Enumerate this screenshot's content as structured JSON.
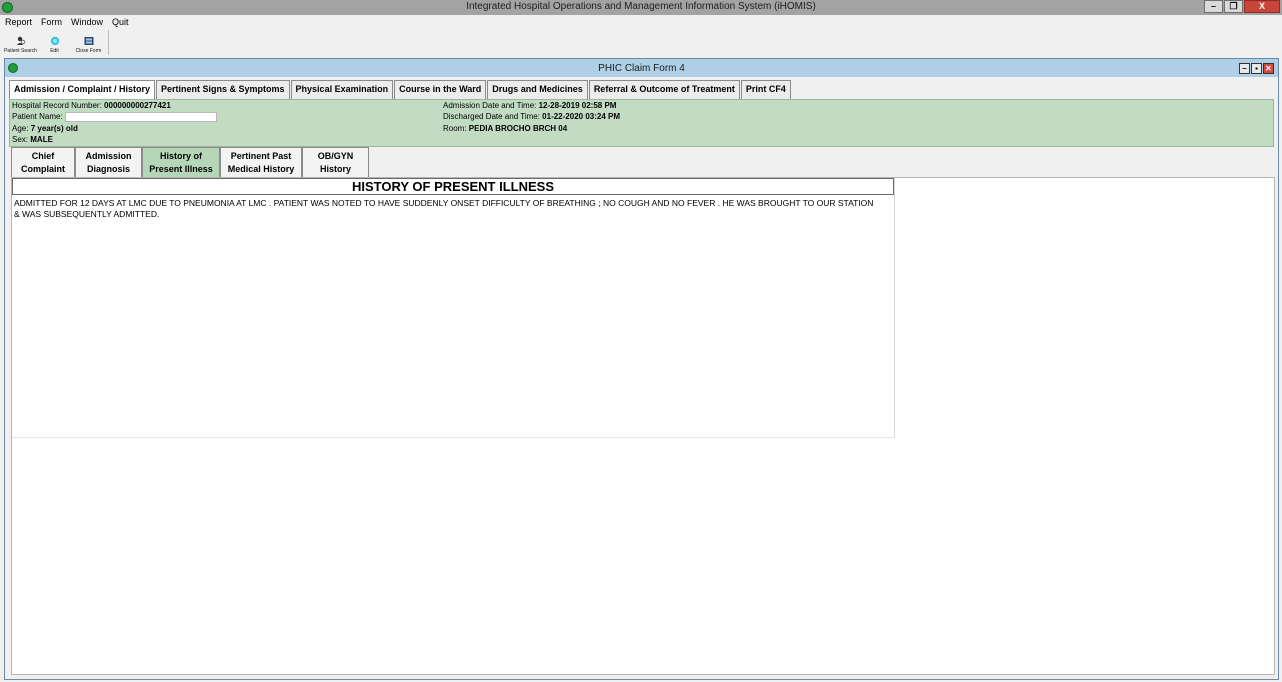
{
  "app": {
    "title": "Integrated Hospital Operations and Management Information System (iHOMIS)"
  },
  "window_controls": {
    "minimize": "–",
    "restore": "❐",
    "close": "X"
  },
  "menu": [
    {
      "label": "Report"
    },
    {
      "label": "Form"
    },
    {
      "label": "Window"
    },
    {
      "label": "Quit"
    }
  ],
  "toolbar": [
    {
      "label": "Patient Search",
      "icon": "patient-search-icon"
    },
    {
      "label": "Edit",
      "icon": "edit-icon"
    },
    {
      "label": "Close Form",
      "icon": "close-form-icon"
    }
  ],
  "child": {
    "title": "PHIC Claim Form 4",
    "controls": {
      "minimize": "–",
      "maximize": "▪",
      "close": "✕"
    }
  },
  "tabs": [
    {
      "label": "Admission / Complaint / History",
      "active": true
    },
    {
      "label": "Pertinent Signs & Symptoms"
    },
    {
      "label": "Physical Examination"
    },
    {
      "label": "Course in the Ward"
    },
    {
      "label": "Drugs and Medicines"
    },
    {
      "label": "Referral & Outcome of Treatment"
    },
    {
      "label": "Print CF4"
    }
  ],
  "patient": {
    "hrn_label": "Hospital Record Number:",
    "hrn": "000000000277421",
    "name_label": "Patient Name:",
    "name_value": "",
    "age_label": "Age:",
    "age": "7 year(s) old",
    "sex_label": "Sex:",
    "sex": "MALE",
    "admission_label": "Admission Date and Time:",
    "admission": "12-28-2019 02:58 PM",
    "discharged_label": "Discharged Date and Time:",
    "discharged": "01-22-2020 03:24 PM",
    "room_label": "Room:",
    "room": "PEDIA BROCHO BRCH 04"
  },
  "subtabs": [
    {
      "line1": "Chief",
      "line2": "Complaint"
    },
    {
      "line1": "Admission",
      "line2": "Diagnosis"
    },
    {
      "line1": "History of",
      "line2": "Present Illness",
      "active": true
    },
    {
      "line1": "Pertinent Past",
      "line2": "Medical History"
    },
    {
      "line1": "OB/GYN",
      "line2": "History"
    }
  ],
  "hpi": {
    "header": "HISTORY OF PRESENT ILLNESS",
    "text": "ADMITTED FOR 12 DAYS AT LMC DUE TO PNEUMONIA AT LMC . PATIENT WAS NOTED TO HAVE SUDDENLY ONSET DIFFICULTY OF BREATHING ; NO COUGH AND NO FEVER . HE WAS BROUGHT TO OUR STATION & WAS SUBSEQUENTLY ADMITTED."
  }
}
